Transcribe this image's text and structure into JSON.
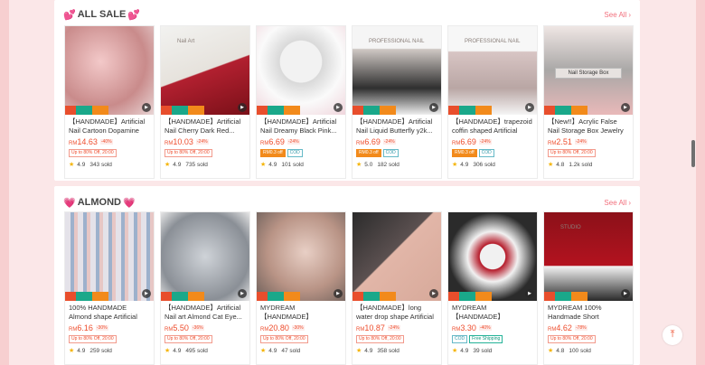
{
  "sections": [
    {
      "title": "ALL SALE",
      "see_all": "See All",
      "products": [
        {
          "title": "【HANDMADE】Artificial Nail Cartoon Dopamine Gi...",
          "price": "14.63",
          "discount": "-40%",
          "tags": [
            {
              "text": "Up to 80% Off, 20:00",
              "style": "outline"
            }
          ],
          "rating": "4.9",
          "sold": "343 sold"
        },
        {
          "title": "【HANDMADE】Artificial Nail Cherry Dark Red...",
          "price": "10.03",
          "discount": "-24%",
          "tags": [
            {
              "text": "Up to 80% Off, 20:00",
              "style": "outline"
            }
          ],
          "rating": "4.9",
          "sold": "735 sold",
          "image_text": "Nail Art"
        },
        {
          "title": "【HANDMADE】Artificial Nail Dreamy Black Pink...",
          "price": "6.69",
          "discount": "-24%",
          "tags": [
            {
              "text": "RM0.3 off",
              "style": "solid"
            },
            {
              "text": "COD",
              "style": "cod"
            }
          ],
          "rating": "4.9",
          "sold": "101 sold"
        },
        {
          "title": "【HANDMADE】Artificial Nail Liquid Butterfly y2k...",
          "price": "6.69",
          "discount": "-24%",
          "tags": [
            {
              "text": "RM0.3 off",
              "style": "solid"
            },
            {
              "text": "COD",
              "style": "cod"
            }
          ],
          "rating": "5.0",
          "sold": "182 sold",
          "image_text": "PROFESSIONAL NAIL"
        },
        {
          "title": "【HANDMADE】trapezoid coffin shaped Artificial Nai...",
          "price": "6.69",
          "discount": "-24%",
          "tags": [
            {
              "text": "RM0.3 off",
              "style": "solid"
            },
            {
              "text": "COD",
              "style": "cod"
            }
          ],
          "rating": "4.9",
          "sold": "306 sold",
          "image_text": "PROFESSIONAL NAIL"
        },
        {
          "title": "【New!!】Acrylic False Nail Storage Box Jewelry Gift...",
          "price": "2.51",
          "discount": "-24%",
          "tags": [
            {
              "text": "Up to 80% Off, 20:00",
              "style": "outline"
            }
          ],
          "rating": "4.8",
          "sold": "1.2k sold",
          "image_text": "Nail Storage Box"
        }
      ]
    },
    {
      "title": "ALMOND",
      "see_all": "See All",
      "products": [
        {
          "title": "100% HANDMADE Almond shape Artificial Nail Art...",
          "price": "6.16",
          "discount": "-30%",
          "tags": [
            {
              "text": "Up to 80% Off, 20:00",
              "style": "outline"
            }
          ],
          "rating": "4.9",
          "sold": "259 sold"
        },
        {
          "title": "【HANDMADE】Artificial Nail art Almond Cat Eye...",
          "price": "5.50",
          "discount": "-36%",
          "tags": [
            {
              "text": "Up to 80% Off, 20:00",
              "style": "outline"
            }
          ],
          "rating": "4.9",
          "sold": "495 sold"
        },
        {
          "title": "MYDREAM 【HANDMADE】Artificial...",
          "price": "20.80",
          "discount": "-30%",
          "tags": [
            {
              "text": "Up to 80% Off, 20:00",
              "style": "outline"
            }
          ],
          "rating": "4.9",
          "sold": "47 sold"
        },
        {
          "title": "【HANDMADE】long water drop shape Artificial Nail a...",
          "price": "10.87",
          "discount": "-24%",
          "tags": [
            {
              "text": "Up to 80% Off, 20:00",
              "style": "outline"
            }
          ],
          "rating": "4.9",
          "sold": "358 sold"
        },
        {
          "title": "MYDREAM 【HANDMADE】Artificial...",
          "price": "3.30",
          "discount": "-40%",
          "tags": [
            {
              "text": "COD",
              "style": "cod"
            },
            {
              "text": "Free Shipping",
              "style": "ship"
            }
          ],
          "rating": "4.9",
          "sold": "39 sold"
        },
        {
          "title": "MYDREAM 100% Handmade Short Almond...",
          "price": "4.62",
          "discount": "-78%",
          "tags": [
            {
              "text": "Up to 80% Off, 20:00",
              "style": "outline"
            }
          ],
          "rating": "4.8",
          "sold": "100 sold",
          "image_text": "STUDIO"
        }
      ]
    }
  ],
  "currency": "RM",
  "colors": {
    "accent": "#ee4d2d",
    "page_bg": "#f7cfd0",
    "star": "#f5b400"
  },
  "icons": {
    "heart": "heart-icon",
    "chevron": "chevron-right-icon",
    "star": "star-icon",
    "play": "play-icon",
    "to_top": "arrow-up-icon"
  }
}
